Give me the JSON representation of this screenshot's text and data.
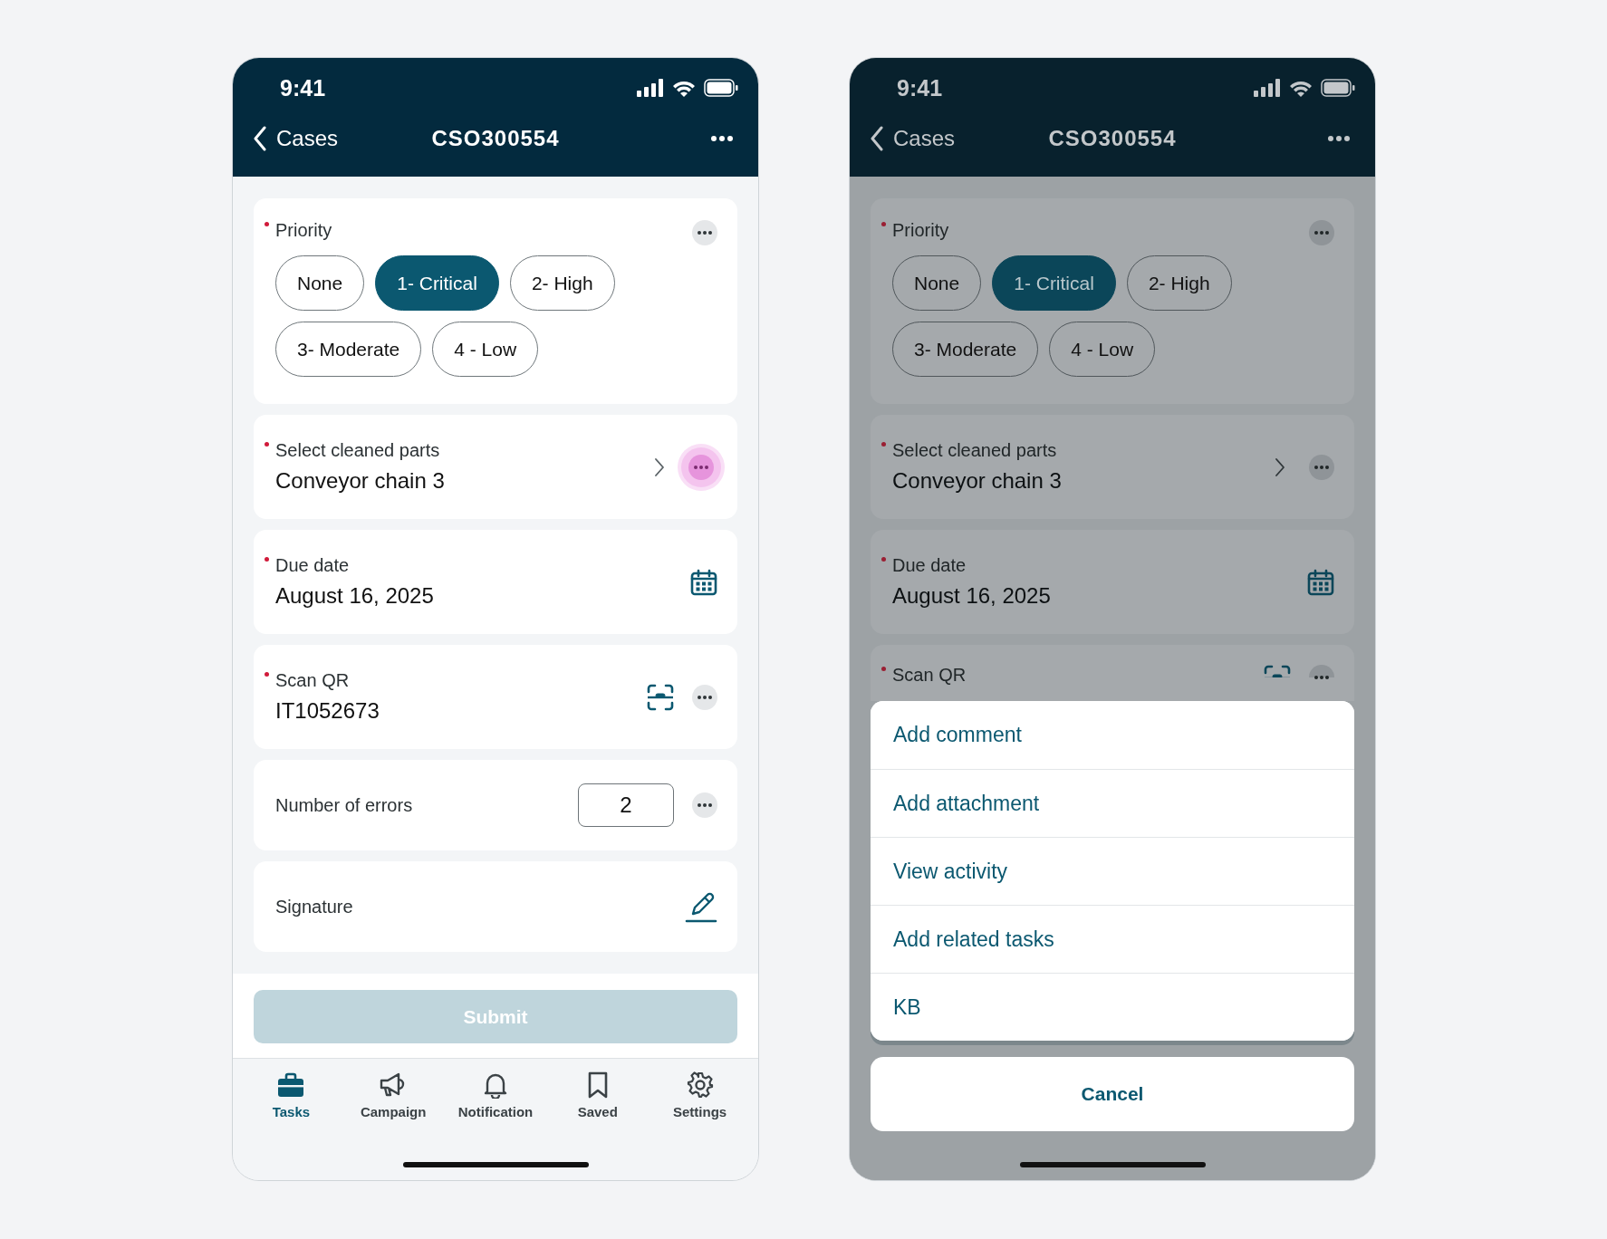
{
  "screens": [
    {
      "dimmed": false,
      "status_bar": {
        "time": "9:41"
      },
      "nav": {
        "back": "Cases",
        "title": "CSO300554"
      },
      "fields": [
        {
          "kind": "chips",
          "label": "Priority",
          "required": true,
          "menu": true,
          "options": [
            {
              "label": "None",
              "selected": false
            },
            {
              "label": "1- Critical",
              "selected": true
            },
            {
              "label": "2- High",
              "selected": false
            },
            {
              "label": "3- Moderate",
              "selected": false
            },
            {
              "label": "4 - Low",
              "selected": false
            }
          ]
        },
        {
          "kind": "picker",
          "label": "Select cleaned parts",
          "required": true,
          "value": "Conveyor chain 3",
          "menu": true,
          "menu_focused": true
        },
        {
          "kind": "date",
          "label": "Due date",
          "required": true,
          "value": "August 16, 2025"
        },
        {
          "kind": "scan",
          "label": "Scan QR",
          "required": true,
          "value": "IT1052673",
          "menu": true,
          "cut_off": false
        },
        {
          "kind": "number",
          "label": "Number of errors",
          "required": false,
          "value": "2",
          "menu": true
        },
        {
          "kind": "signature",
          "label": "Signature",
          "required": false
        }
      ],
      "submit": {
        "label": "Submit",
        "disabled": true
      },
      "tab_bar": [
        {
          "label": "Tasks",
          "selected": true
        },
        {
          "label": "Campaign",
          "selected": false
        },
        {
          "label": "Notification",
          "selected": false
        },
        {
          "label": "Saved",
          "selected": false
        },
        {
          "label": "Settings",
          "selected": false
        }
      ]
    },
    {
      "dimmed": true,
      "status_bar": {
        "time": "9:41"
      },
      "nav": {
        "back": "Cases",
        "title": "CSO300554"
      },
      "fields": [
        {
          "kind": "chips",
          "label": "Priority",
          "required": true,
          "menu": true,
          "options": [
            {
              "label": "None",
              "selected": false
            },
            {
              "label": "1- Critical",
              "selected": true
            },
            {
              "label": "2- High",
              "selected": false
            },
            {
              "label": "3- Moderate",
              "selected": false
            },
            {
              "label": "4 - Low",
              "selected": false
            }
          ]
        },
        {
          "kind": "picker",
          "label": "Select cleaned parts",
          "required": true,
          "value": "Conveyor chain 3",
          "menu": true,
          "menu_focused": false
        },
        {
          "kind": "date",
          "label": "Due date",
          "required": true,
          "value": "August 16, 2025"
        },
        {
          "kind": "scan",
          "label": "Scan QR",
          "required": true,
          "menu": true,
          "cut_off": true
        }
      ],
      "action_sheet": {
        "items": [
          "Add comment",
          "Add attachment",
          "View activity",
          "Add related tasks",
          "KB"
        ],
        "cancel": "Cancel"
      }
    }
  ]
}
